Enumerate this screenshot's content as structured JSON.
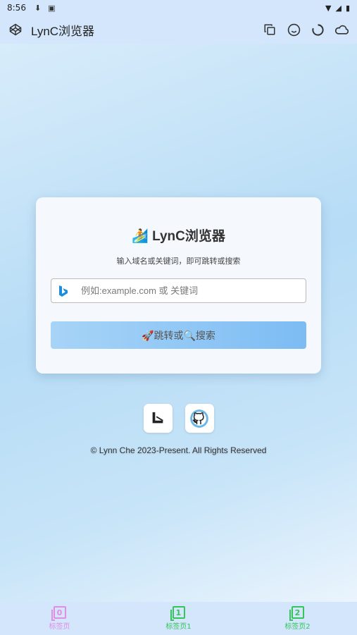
{
  "status": {
    "time": "8:56"
  },
  "appbar": {
    "title": "LynC浏览器"
  },
  "card": {
    "emoji": "🏄",
    "title": "LynC浏览器",
    "subtitle": "输入域名或关键词，即可跳转或搜索",
    "search_placeholder": "例如:example.com 或 关键词",
    "go_label": "🚀跳转或🔍搜索"
  },
  "footer": {
    "copyright": "© Lynn Che 2023-Present. All Rights Reserved"
  },
  "tabs": [
    {
      "label": "标签页",
      "index": "0"
    },
    {
      "label": "标签页1",
      "index": "1"
    },
    {
      "label": "标签页2",
      "index": "2"
    }
  ],
  "colors": {
    "accent": "#8ec6f5",
    "tab_active": "#e28ce6",
    "tab_inactive": "#34c45a"
  }
}
